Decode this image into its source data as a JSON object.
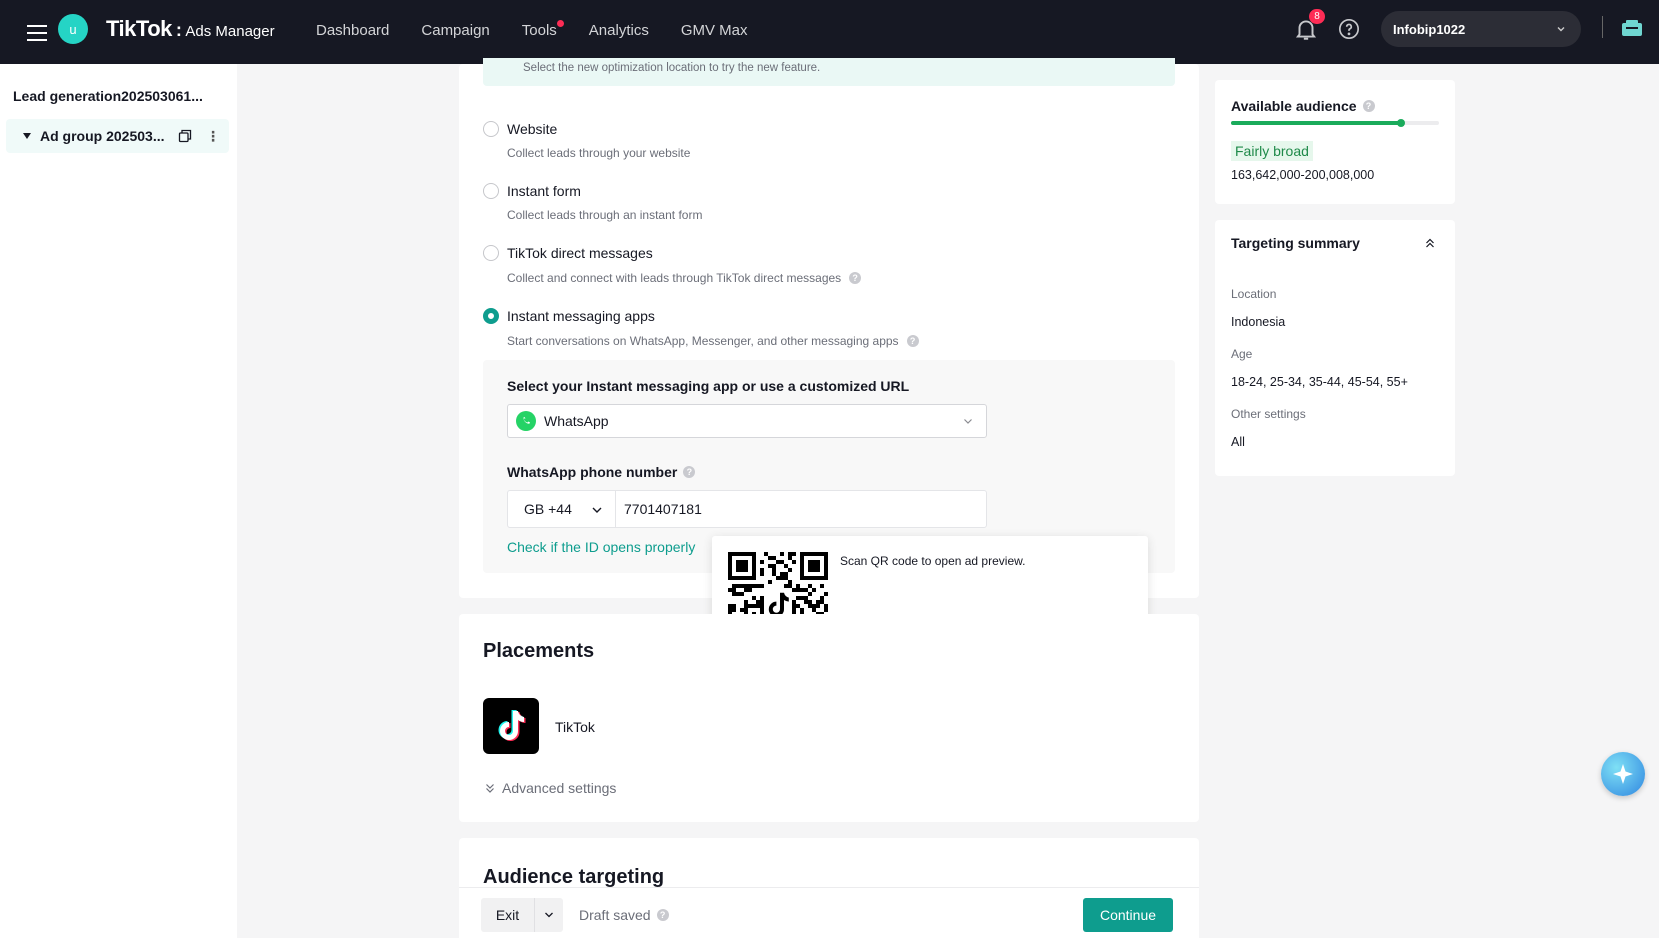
{
  "topbar": {
    "avatar_letter": "u",
    "logo_main": "TikTok",
    "logo_sub": "Ads Manager",
    "nav": [
      "Dashboard",
      "Campaign",
      "Tools",
      "Analytics",
      "GMV Max"
    ],
    "notification_count": "8",
    "account_name": "Infobip1022"
  },
  "sidebar": {
    "campaign_name": "Lead generation202503061...",
    "ad_group_name": "Ad group 202503..."
  },
  "optimization": {
    "banner_text": "Select the new optimization location to try the new feature.",
    "options": [
      {
        "label": "Website",
        "desc": "Collect leads through your website",
        "selected": false
      },
      {
        "label": "Instant form",
        "desc": "Collect leads through an instant form",
        "selected": false
      },
      {
        "label": "TikTok direct messages",
        "desc": "Collect and connect with leads through TikTok direct messages",
        "selected": false
      },
      {
        "label": "Instant messaging apps",
        "desc": "Start conversations on WhatsApp, Messenger, and other messaging apps",
        "selected": true
      }
    ],
    "im_title": "Select your Instant messaging app or use a customized URL",
    "im_app": "WhatsApp",
    "phone_label": "WhatsApp phone number",
    "country_code": "GB +44",
    "phone_value": "7701407181",
    "check_link": "Check if the ID opens properly",
    "qr_text": "Scan QR code to open ad preview."
  },
  "placements": {
    "title": "Placements",
    "platform": "TikTok",
    "advanced": "Advanced settings"
  },
  "audience_section": {
    "title": "Audience targeting"
  },
  "footer": {
    "exit": "Exit",
    "draft": "Draft saved",
    "continue": "Continue"
  },
  "audience": {
    "title": "Available audience",
    "breadth_level": 0.82,
    "tag": "Fairly broad",
    "range": "163,642,000-200,008,000"
  },
  "targeting": {
    "title": "Targeting summary",
    "location_label": "Location",
    "location_value": "Indonesia",
    "age_label": "Age",
    "age_value": "18-24, 25-34, 35-44, 45-54, 55+",
    "other_label": "Other settings",
    "other_value": "All"
  },
  "colors": {
    "accent": "#0e9d8e",
    "topbar": "#161823",
    "audience_green": "#1aab5b"
  }
}
